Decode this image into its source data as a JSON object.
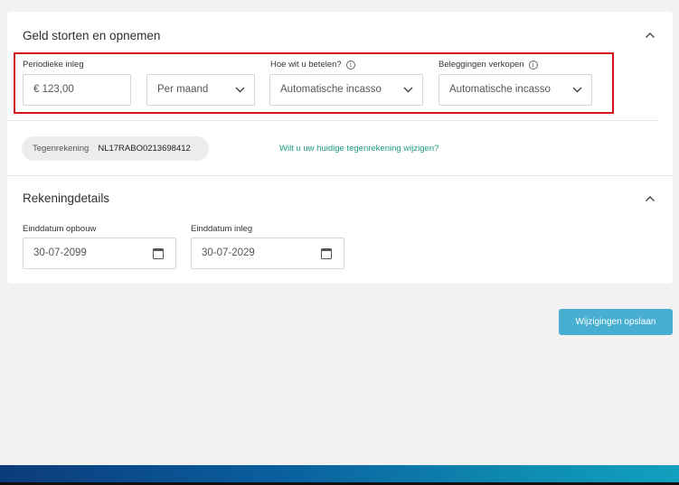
{
  "section_deposit": {
    "title": "Geld storten en opnemen",
    "fields": {
      "periodic": {
        "label": "Periodieke inleg",
        "value": "€ 123,00"
      },
      "frequency": {
        "value": "Per maand"
      },
      "payment": {
        "label": "Hoe wit u betelen?",
        "value": "Automatische incasso"
      },
      "sell": {
        "label": "Beleggingen verkopen",
        "value": "Automatische incasso"
      }
    },
    "counter_account": {
      "label": "Tegenrekening",
      "value": "NL17RABO0213698412"
    },
    "change_link": "Wilt u uw huidige tegenrekening wijzigen?"
  },
  "section_details": {
    "title": "Rekeningdetails",
    "fields": {
      "end_build": {
        "label": "Einddatum opbouw",
        "value": "30-07-2099"
      },
      "end_deposit": {
        "label": "Einddatum inleg",
        "value": "30-07-2029"
      }
    }
  },
  "save_button": "Wijzigingen opslaan",
  "info_icon_glyph": "i",
  "colors": {
    "highlight": "#d1151c",
    "link": "#1a9a82",
    "button": "#49afd2"
  }
}
